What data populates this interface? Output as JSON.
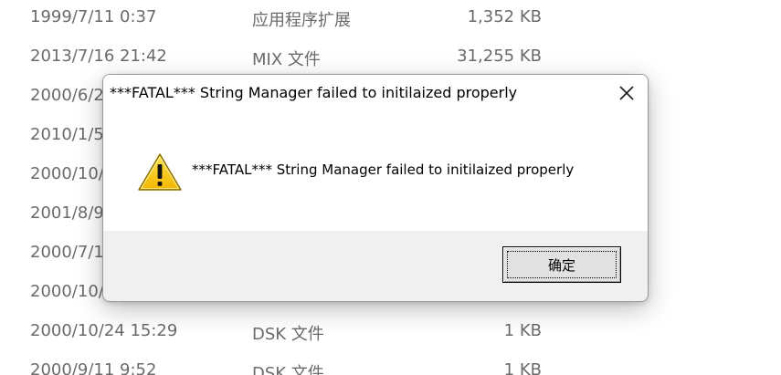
{
  "file_list": {
    "rows": [
      {
        "date": "1999/7/11 0:37",
        "type": "应用程序扩展",
        "size": "1,352 KB"
      },
      {
        "date": "2013/7/16 21:42",
        "type": "MIX 文件",
        "size": "31,255 KB"
      },
      {
        "date": "2000/6/2",
        "type": "",
        "size": ""
      },
      {
        "date": "2010/1/5",
        "type": "",
        "size": ""
      },
      {
        "date": "2000/10/",
        "type": "",
        "size": ""
      },
      {
        "date": "2001/8/9",
        "type": "",
        "size": ""
      },
      {
        "date": "2000/7/1",
        "type": "",
        "size": ""
      },
      {
        "date": "2000/10/",
        "type": "",
        "size": ""
      },
      {
        "date": "2000/10/24 15:29",
        "type": "DSK 文件",
        "size": "1 KB"
      },
      {
        "date": "2000/9/11 9:52",
        "type": "DSK 文件",
        "size": "1 KB"
      }
    ]
  },
  "dialog": {
    "title": "***FATAL*** String Manager failed to initilaized properly",
    "message": "***FATAL*** String Manager failed to initilaized properly",
    "ok_label": "确定",
    "icon": "warning-icon",
    "close_icon": "close-icon"
  },
  "colors": {
    "warning_yellow": "#f5c400",
    "dialog_bg": "#f0f0f0",
    "list_text": "#6b6b6b"
  }
}
